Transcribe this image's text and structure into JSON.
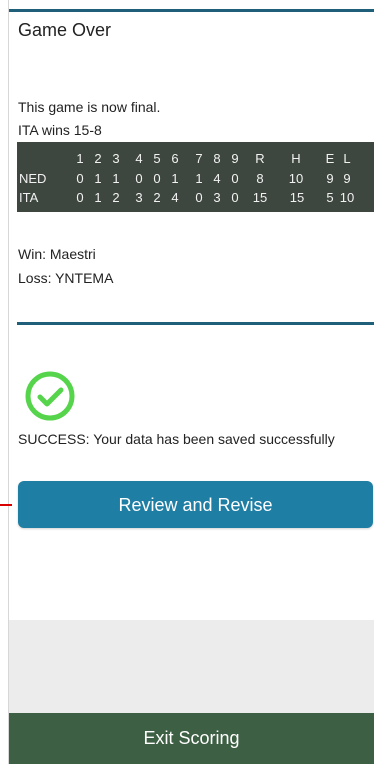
{
  "header": {
    "title": "Game Over"
  },
  "result": {
    "final_text": "This game is now final.",
    "winner_text": "ITA wins 15-8"
  },
  "scoreboard": {
    "headers": [
      "1",
      "2",
      "3",
      "4",
      "5",
      "6",
      "7",
      "8",
      "9",
      "R",
      "H",
      "E",
      "L"
    ],
    "rows": [
      {
        "team": "NED",
        "values": [
          "0",
          "1",
          "1",
          "0",
          "0",
          "1",
          "1",
          "4",
          "0",
          "8",
          "10",
          "9",
          "9"
        ]
      },
      {
        "team": "ITA",
        "values": [
          "0",
          "1",
          "2",
          "3",
          "2",
          "4",
          "0",
          "3",
          "0",
          "15",
          "15",
          "5",
          "10"
        ]
      }
    ],
    "highlight_color": "#5b6f84",
    "bg_color": "#3d463f"
  },
  "pitchers": {
    "win": "Win: Maestri",
    "loss": "Loss: YNTEMA"
  },
  "status": {
    "icon": "check-circle-icon",
    "message": "SUCCESS: Your data has been saved successfully"
  },
  "actions": {
    "review_label": "Review and Revise",
    "exit_label": "Exit Scoring"
  },
  "colors": {
    "accent_blue": "#1f7ea4",
    "rule_blue": "#1f5f79",
    "success_green": "#56d44b",
    "exit_green": "#3d5f43",
    "gray_panel": "#ececec"
  }
}
